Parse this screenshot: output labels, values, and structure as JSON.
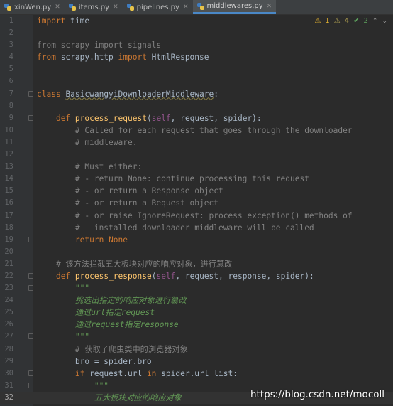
{
  "tabs": [
    {
      "label": "xinWen.py",
      "active": false
    },
    {
      "label": "items.py",
      "active": false
    },
    {
      "label": "pipelines.py",
      "active": false
    },
    {
      "label": "middlewares.py",
      "active": true
    }
  ],
  "inspections": {
    "warnings": "1",
    "weak_warnings": "4",
    "typos": "2"
  },
  "lines": [
    {
      "n": "1",
      "seg": [
        [
          "kw",
          "import"
        ],
        [
          "",
          " time"
        ]
      ]
    },
    {
      "n": "2",
      "seg": []
    },
    {
      "n": "3",
      "seg": [
        [
          "cm",
          "from scrapy import signals"
        ]
      ]
    },
    {
      "n": "4",
      "seg": [
        [
          "kw",
          "from"
        ],
        [
          "",
          " scrapy.http "
        ],
        [
          "kw",
          "import"
        ],
        [
          "",
          " HtmlResponse"
        ]
      ]
    },
    {
      "n": "5",
      "seg": []
    },
    {
      "n": "6",
      "seg": []
    },
    {
      "n": "7",
      "seg": [
        [
          "kw",
          "class"
        ],
        [
          "",
          " "
        ],
        [
          "cls",
          "BasicwangyiDownloaderMiddleware"
        ],
        [
          "",
          ":"
        ]
      ]
    },
    {
      "n": "8",
      "seg": []
    },
    {
      "n": "9",
      "seg": [
        [
          "",
          "    "
        ],
        [
          "kw",
          "def"
        ],
        [
          "",
          " "
        ],
        [
          "fn",
          "process_request"
        ],
        [
          "",
          "("
        ],
        [
          "self",
          "self"
        ],
        [
          "",
          ", request, spider):"
        ]
      ]
    },
    {
      "n": "10",
      "seg": [
        [
          "",
          "        "
        ],
        [
          "cm",
          "# Called for each request that goes through the downloader"
        ]
      ]
    },
    {
      "n": "11",
      "seg": [
        [
          "",
          "        "
        ],
        [
          "cm",
          "# middleware."
        ]
      ]
    },
    {
      "n": "12",
      "seg": []
    },
    {
      "n": "13",
      "seg": [
        [
          "",
          "        "
        ],
        [
          "cm",
          "# Must either:"
        ]
      ]
    },
    {
      "n": "14",
      "seg": [
        [
          "",
          "        "
        ],
        [
          "cm",
          "# - return None: continue processing this request"
        ]
      ]
    },
    {
      "n": "15",
      "seg": [
        [
          "",
          "        "
        ],
        [
          "cm",
          "# - or return a Response object"
        ]
      ]
    },
    {
      "n": "16",
      "seg": [
        [
          "",
          "        "
        ],
        [
          "cm",
          "# - or return a Request object"
        ]
      ]
    },
    {
      "n": "17",
      "seg": [
        [
          "",
          "        "
        ],
        [
          "cm",
          "# - or raise IgnoreRequest: process_exception() methods of"
        ]
      ]
    },
    {
      "n": "18",
      "seg": [
        [
          "",
          "        "
        ],
        [
          "cm",
          "#   installed downloader middleware will be called"
        ]
      ]
    },
    {
      "n": "19",
      "seg": [
        [
          "",
          "        "
        ],
        [
          "kw",
          "return"
        ],
        [
          "",
          " "
        ],
        [
          "kw",
          "None"
        ]
      ]
    },
    {
      "n": "20",
      "seg": []
    },
    {
      "n": "21",
      "seg": [
        [
          "",
          "    "
        ],
        [
          "cm",
          "# 该方法拦截五大板块对应的响应对象，进行篡改"
        ]
      ]
    },
    {
      "n": "22",
      "seg": [
        [
          "",
          "    "
        ],
        [
          "kw",
          "def"
        ],
        [
          "",
          " "
        ],
        [
          "fn",
          "process_response"
        ],
        [
          "",
          "("
        ],
        [
          "self",
          "self"
        ],
        [
          "",
          ", request, response, spider):"
        ]
      ]
    },
    {
      "n": "23",
      "seg": [
        [
          "",
          "        "
        ],
        [
          "ds",
          "\"\"\""
        ]
      ]
    },
    {
      "n": "24",
      "seg": [
        [
          "",
          "        "
        ],
        [
          "ds",
          "挑选出指定的响应对象进行篡改"
        ]
      ]
    },
    {
      "n": "25",
      "seg": [
        [
          "",
          "        "
        ],
        [
          "ds",
          "通过url指定request"
        ]
      ]
    },
    {
      "n": "26",
      "seg": [
        [
          "",
          "        "
        ],
        [
          "ds",
          "通过request指定response"
        ]
      ]
    },
    {
      "n": "27",
      "seg": [
        [
          "",
          "        "
        ],
        [
          "ds",
          "\"\"\""
        ]
      ]
    },
    {
      "n": "28",
      "seg": [
        [
          "",
          "        "
        ],
        [
          "cm",
          "# 获取了爬虫类中的浏览器对象"
        ]
      ]
    },
    {
      "n": "29",
      "seg": [
        [
          "",
          "        bro = spider.bro"
        ]
      ]
    },
    {
      "n": "30",
      "seg": [
        [
          "",
          "        "
        ],
        [
          "kw",
          "if"
        ],
        [
          "",
          " request.url "
        ],
        [
          "kw",
          "in"
        ],
        [
          "",
          " spider.url_list:"
        ]
      ]
    },
    {
      "n": "31",
      "seg": [
        [
          "",
          "            "
        ],
        [
          "ds",
          "\"\"\""
        ]
      ]
    },
    {
      "n": "32",
      "seg": [
        [
          "",
          "            "
        ],
        [
          "ds",
          "五大板块对应的响应对象"
        ]
      ]
    }
  ],
  "fold_lines": [
    "7",
    "9",
    "19",
    "22",
    "23",
    "27",
    "30",
    "31"
  ],
  "current_line": "32",
  "watermark": "https://blog.csdn.net/mocoll"
}
